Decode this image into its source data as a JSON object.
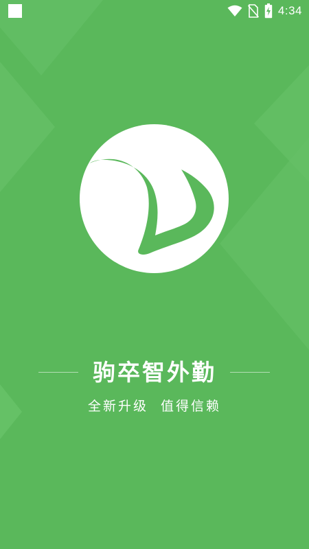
{
  "status_bar": {
    "time": "4:34",
    "icons": [
      "notification-square-icon",
      "wifi-icon",
      "no-sim-icon",
      "battery-charging-icon"
    ]
  },
  "splash": {
    "logo_icon": "y-leaf-logo-icon",
    "title": "驹卒智外勤",
    "subtitle": "全新升级  值得信赖"
  },
  "colors": {
    "background": "#5ab85b",
    "accent_shape": "#6cc46d",
    "text": "#ffffff"
  }
}
